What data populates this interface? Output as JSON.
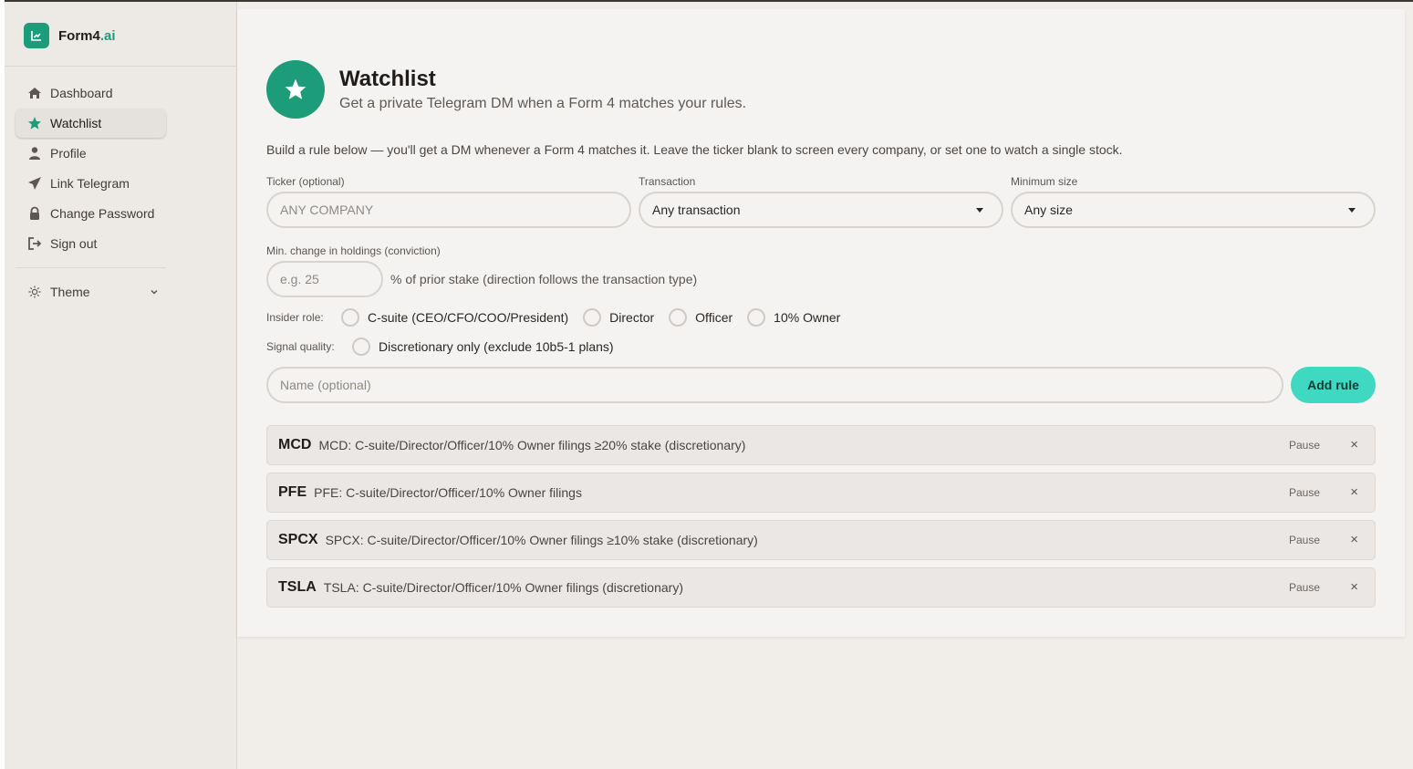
{
  "brand": {
    "name": "Form4",
    "suffix": ".ai"
  },
  "sidebar": {
    "items": [
      {
        "label": "Dashboard",
        "icon": "home-icon"
      },
      {
        "label": "Watchlist",
        "icon": "star-icon",
        "active": true
      },
      {
        "label": "Profile",
        "icon": "user-icon"
      },
      {
        "label": "Link Telegram",
        "icon": "send-icon"
      },
      {
        "label": "Change Password",
        "icon": "lock-icon"
      },
      {
        "label": "Sign out",
        "icon": "sign-out-icon"
      }
    ],
    "theme_label": "Theme"
  },
  "header": {
    "title": "Watchlist",
    "subtitle": "Get a private Telegram DM when a Form 4 matches your rules."
  },
  "intro": "Build a rule below — you'll get a DM whenever a Form 4 matches it. Leave the ticker blank to screen every company, or set one to watch a single stock.",
  "form": {
    "ticker_label": "Ticker (optional)",
    "ticker_placeholder": "ANY COMPANY",
    "transaction_label": "Transaction",
    "transaction_value": "Any transaction",
    "size_label": "Minimum size",
    "size_value": "Any size",
    "change_label": "Min. change in holdings (conviction)",
    "change_placeholder": "e.g. 25",
    "change_suffix": "% of prior stake (direction follows the transaction type)",
    "role_label": "Insider role:",
    "roles": [
      "C-suite (CEO/CFO/COO/President)",
      "Director",
      "Officer",
      "10% Owner"
    ],
    "quality_label": "Signal quality:",
    "quality_option": "Discretionary only (exclude 10b5-1 plans)",
    "name_placeholder": "Name (optional)",
    "add_label": "Add rule"
  },
  "rules": [
    {
      "ticker": "MCD",
      "description": "MCD: C-suite/Director/Officer/10% Owner filings ≥20% stake (discretionary)",
      "pause": "Pause",
      "remove": "×"
    },
    {
      "ticker": "PFE",
      "description": "PFE: C-suite/Director/Officer/10% Owner filings",
      "pause": "Pause",
      "remove": "×"
    },
    {
      "ticker": "SPCX",
      "description": "SPCX: C-suite/Director/Officer/10% Owner filings ≥10% stake (discretionary)",
      "pause": "Pause",
      "remove": "×"
    },
    {
      "ticker": "TSLA",
      "description": "TSLA: C-suite/Director/Officer/10% Owner filings (discretionary)",
      "pause": "Pause",
      "remove": "×"
    }
  ],
  "colors": {
    "accent": "#1c9c78",
    "button": "#3fd9c2"
  }
}
